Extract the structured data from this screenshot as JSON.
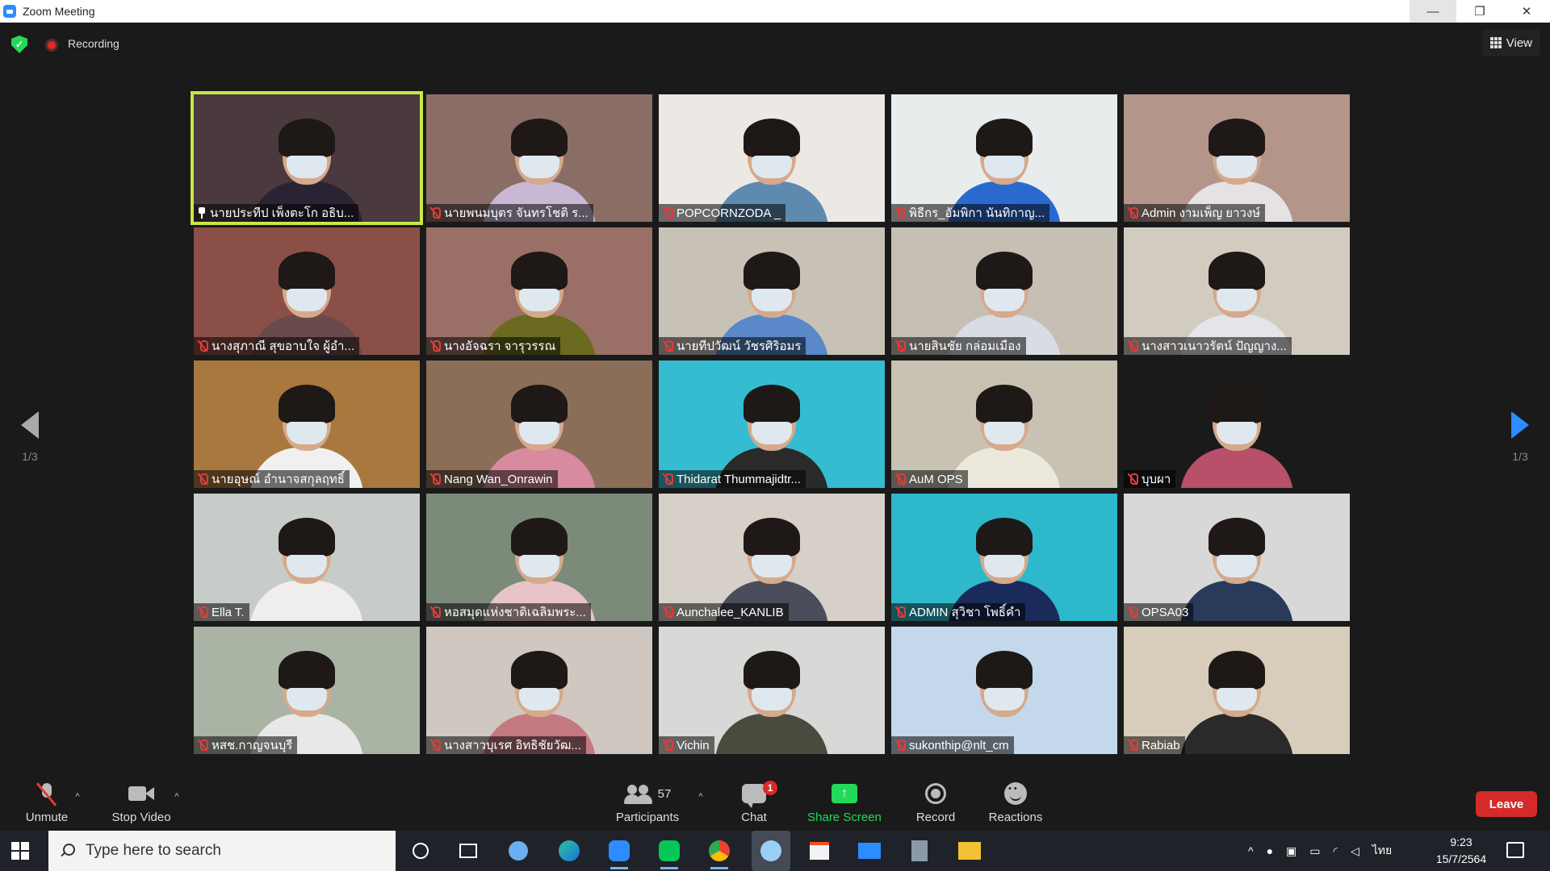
{
  "window": {
    "title": "Zoom Meeting",
    "minimize": "—",
    "restore": "❐",
    "close": "✕"
  },
  "topbar": {
    "recording_label": "Recording",
    "view_label": "View"
  },
  "navigation": {
    "left_page": "1/3",
    "right_page": "1/3"
  },
  "tiles": [
    {
      "name": "นายประทีป เพ็งตะโก อธิบ...",
      "pinned": true,
      "active": true,
      "bg": "#4a3a3e",
      "bodyColor": "#2a2334"
    },
    {
      "name": "นายพนมบุตร จันทรโชติ ร...",
      "bg": "#8a6e66",
      "bodyColor": "#c8b8d4"
    },
    {
      "name": "POPCORNZODA _",
      "bg": "#ece8e4",
      "bodyColor": "#5e8ab0"
    },
    {
      "name": "พิธีกร_อัมพิกา นันทิกาญ...",
      "bg": "#e8ecec",
      "bodyColor": "#2a6ad0"
    },
    {
      "name": "Admin งามเพ็ญ ยาวงษ์",
      "bg": "#b4958a",
      "bodyColor": "#e6e2e4"
    },
    {
      "name": "นางสุภาณี สุขอาบใจ ผู้อำ...",
      "bg": "#8a5048",
      "bodyColor": "#6a4a4a"
    },
    {
      "name": "นางอัจฉรา จารุวรรณ",
      "bg": "#9a7066",
      "bodyColor": "#6a6a20"
    },
    {
      "name": "นายทีปวัฒน์ วัชรศิริอมร",
      "bg": "#c8c2b6",
      "bodyColor": "#5a88c8"
    },
    {
      "name": "นายสินชัย กล่อมเมือง",
      "bg": "#c6c0b4",
      "bodyColor": "#d8dce4"
    },
    {
      "name": "นางสาวเนาวรัตน์ ปัญญาง...",
      "bg": "#d2ccc0",
      "bodyColor": "#e4e4ea"
    },
    {
      "name": "นายอุษณ์ อำนาจสกุลฤทธิ์",
      "bg": "#a8783e",
      "bodyColor": "#f0f0f0"
    },
    {
      "name": "Nang Wan_Onrawin",
      "bg": "#8a6e58",
      "bodyColor": "#d88aa0"
    },
    {
      "name": "Thidarat Thummajidtr...",
      "bg": "#36bcd0",
      "bodyColor": "#2a2a2a"
    },
    {
      "name": "AuM OPS",
      "bg": "#c8c2b2",
      "bodyColor": "#ece8dc"
    },
    {
      "name": "บุบผา",
      "bg": "#1a1a1a",
      "bodyColor": "#b8506a"
    },
    {
      "name": "Ella T.",
      "bg": "#c8ccc8",
      "bodyColor": "#f0eeec"
    },
    {
      "name": "หอสมุดแห่งชาติเฉลิมพระ...",
      "bg": "#7c8a7a",
      "bodyColor": "#e8c4c8"
    },
    {
      "name": "Aunchalee_KANLIB",
      "bg": "#d6d0c8",
      "bodyColor": "#4a4e5a"
    },
    {
      "name": "ADMIN สุวิชา โพธิ์คำ",
      "bg": "#2eb8cc",
      "bodyColor": "#1a2a5a"
    },
    {
      "name": "OPSA03",
      "bg": "#d8d8d8",
      "bodyColor": "#2a3a5a"
    },
    {
      "name": "หสช.กาญจนบุรี",
      "bg": "#aab4a4",
      "bodyColor": "#e8e8e8"
    },
    {
      "name": "นางสาวบุเรศ อิทธิชัยวัฒ...",
      "bg": "#d0c8c0",
      "bodyColor": "#c47880"
    },
    {
      "name": "Vichin",
      "bg": "#d8d8d6",
      "bodyColor": "#4a4a3e"
    },
    {
      "name": "sukonthip@nlt_cm",
      "bg": "#c4d8ec",
      "bodyColor": "#c4d8ec"
    },
    {
      "name": "Rabiab",
      "bg": "#d8cdbb",
      "bodyColor": "#2a2a2a"
    }
  ],
  "controls": {
    "unmute": "Unmute",
    "stop_video": "Stop Video",
    "participants": "Participants",
    "participant_count": "57",
    "chat": "Chat",
    "chat_badge": "1",
    "share_screen": "Share Screen",
    "record": "Record",
    "reactions": "Reactions",
    "leave": "Leave"
  },
  "taskbar": {
    "search_placeholder": "Type here to search",
    "language": "ไทย",
    "time": "9:23",
    "date": "15/7/2564"
  },
  "colors": {
    "active_speaker": "#c9e64a",
    "share_green": "#23d959",
    "leave_red": "#d42a2a",
    "accent_blue": "#2d8cff"
  }
}
